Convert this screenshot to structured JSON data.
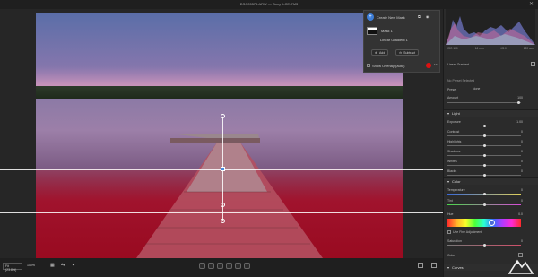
{
  "window": {
    "title": "DSC05576.ARW  —  Sony ILCE-7M3"
  },
  "mask_panel": {
    "create_label": "Create New Mask",
    "mask_name": "Mask 1",
    "component_name": "Linear Gradient 1",
    "add_label": "Add",
    "subtract_label": "Subtract",
    "overlay_label": "Show Overlay (auto)"
  },
  "histogram": {
    "info": [
      "ISO 100",
      "16 mm",
      "f/8.0",
      "120 sec"
    ]
  },
  "right_panel": {
    "tool_name": "Linear Gradient",
    "no_preset": "No Preset Selected",
    "preset_label": "Preset",
    "preset_value": "None",
    "amount_label": "Amount",
    "amount_value": "100",
    "light_section": "Light",
    "light_rows": [
      {
        "label": "Exposure",
        "value": "-1.00"
      },
      {
        "label": "Contrast",
        "value": "0"
      },
      {
        "label": "Highlights",
        "value": "0"
      },
      {
        "label": "Shadows",
        "value": "0"
      },
      {
        "label": "Whites",
        "value": "0"
      },
      {
        "label": "Blacks",
        "value": "0"
      }
    ],
    "color_section": "Color",
    "temperature_label": "Temperature",
    "temperature_value": "0",
    "tint_label": "Tint",
    "tint_value": "0",
    "hue_label": "Hue",
    "hue_value": "0.0",
    "use_fine": "Use Fine Adjustment",
    "saturation_label": "Saturation",
    "saturation_value": "0",
    "color_row_label": "Color",
    "curves_section": "Curves"
  },
  "bottom_bar": {
    "fit_select": "Fit (23.8%)",
    "zoom_value": "100%"
  },
  "colors": {
    "accent": "#3d7ed8",
    "mask_overlay": "#b0102a",
    "overlay_dot": "#dd1111"
  }
}
